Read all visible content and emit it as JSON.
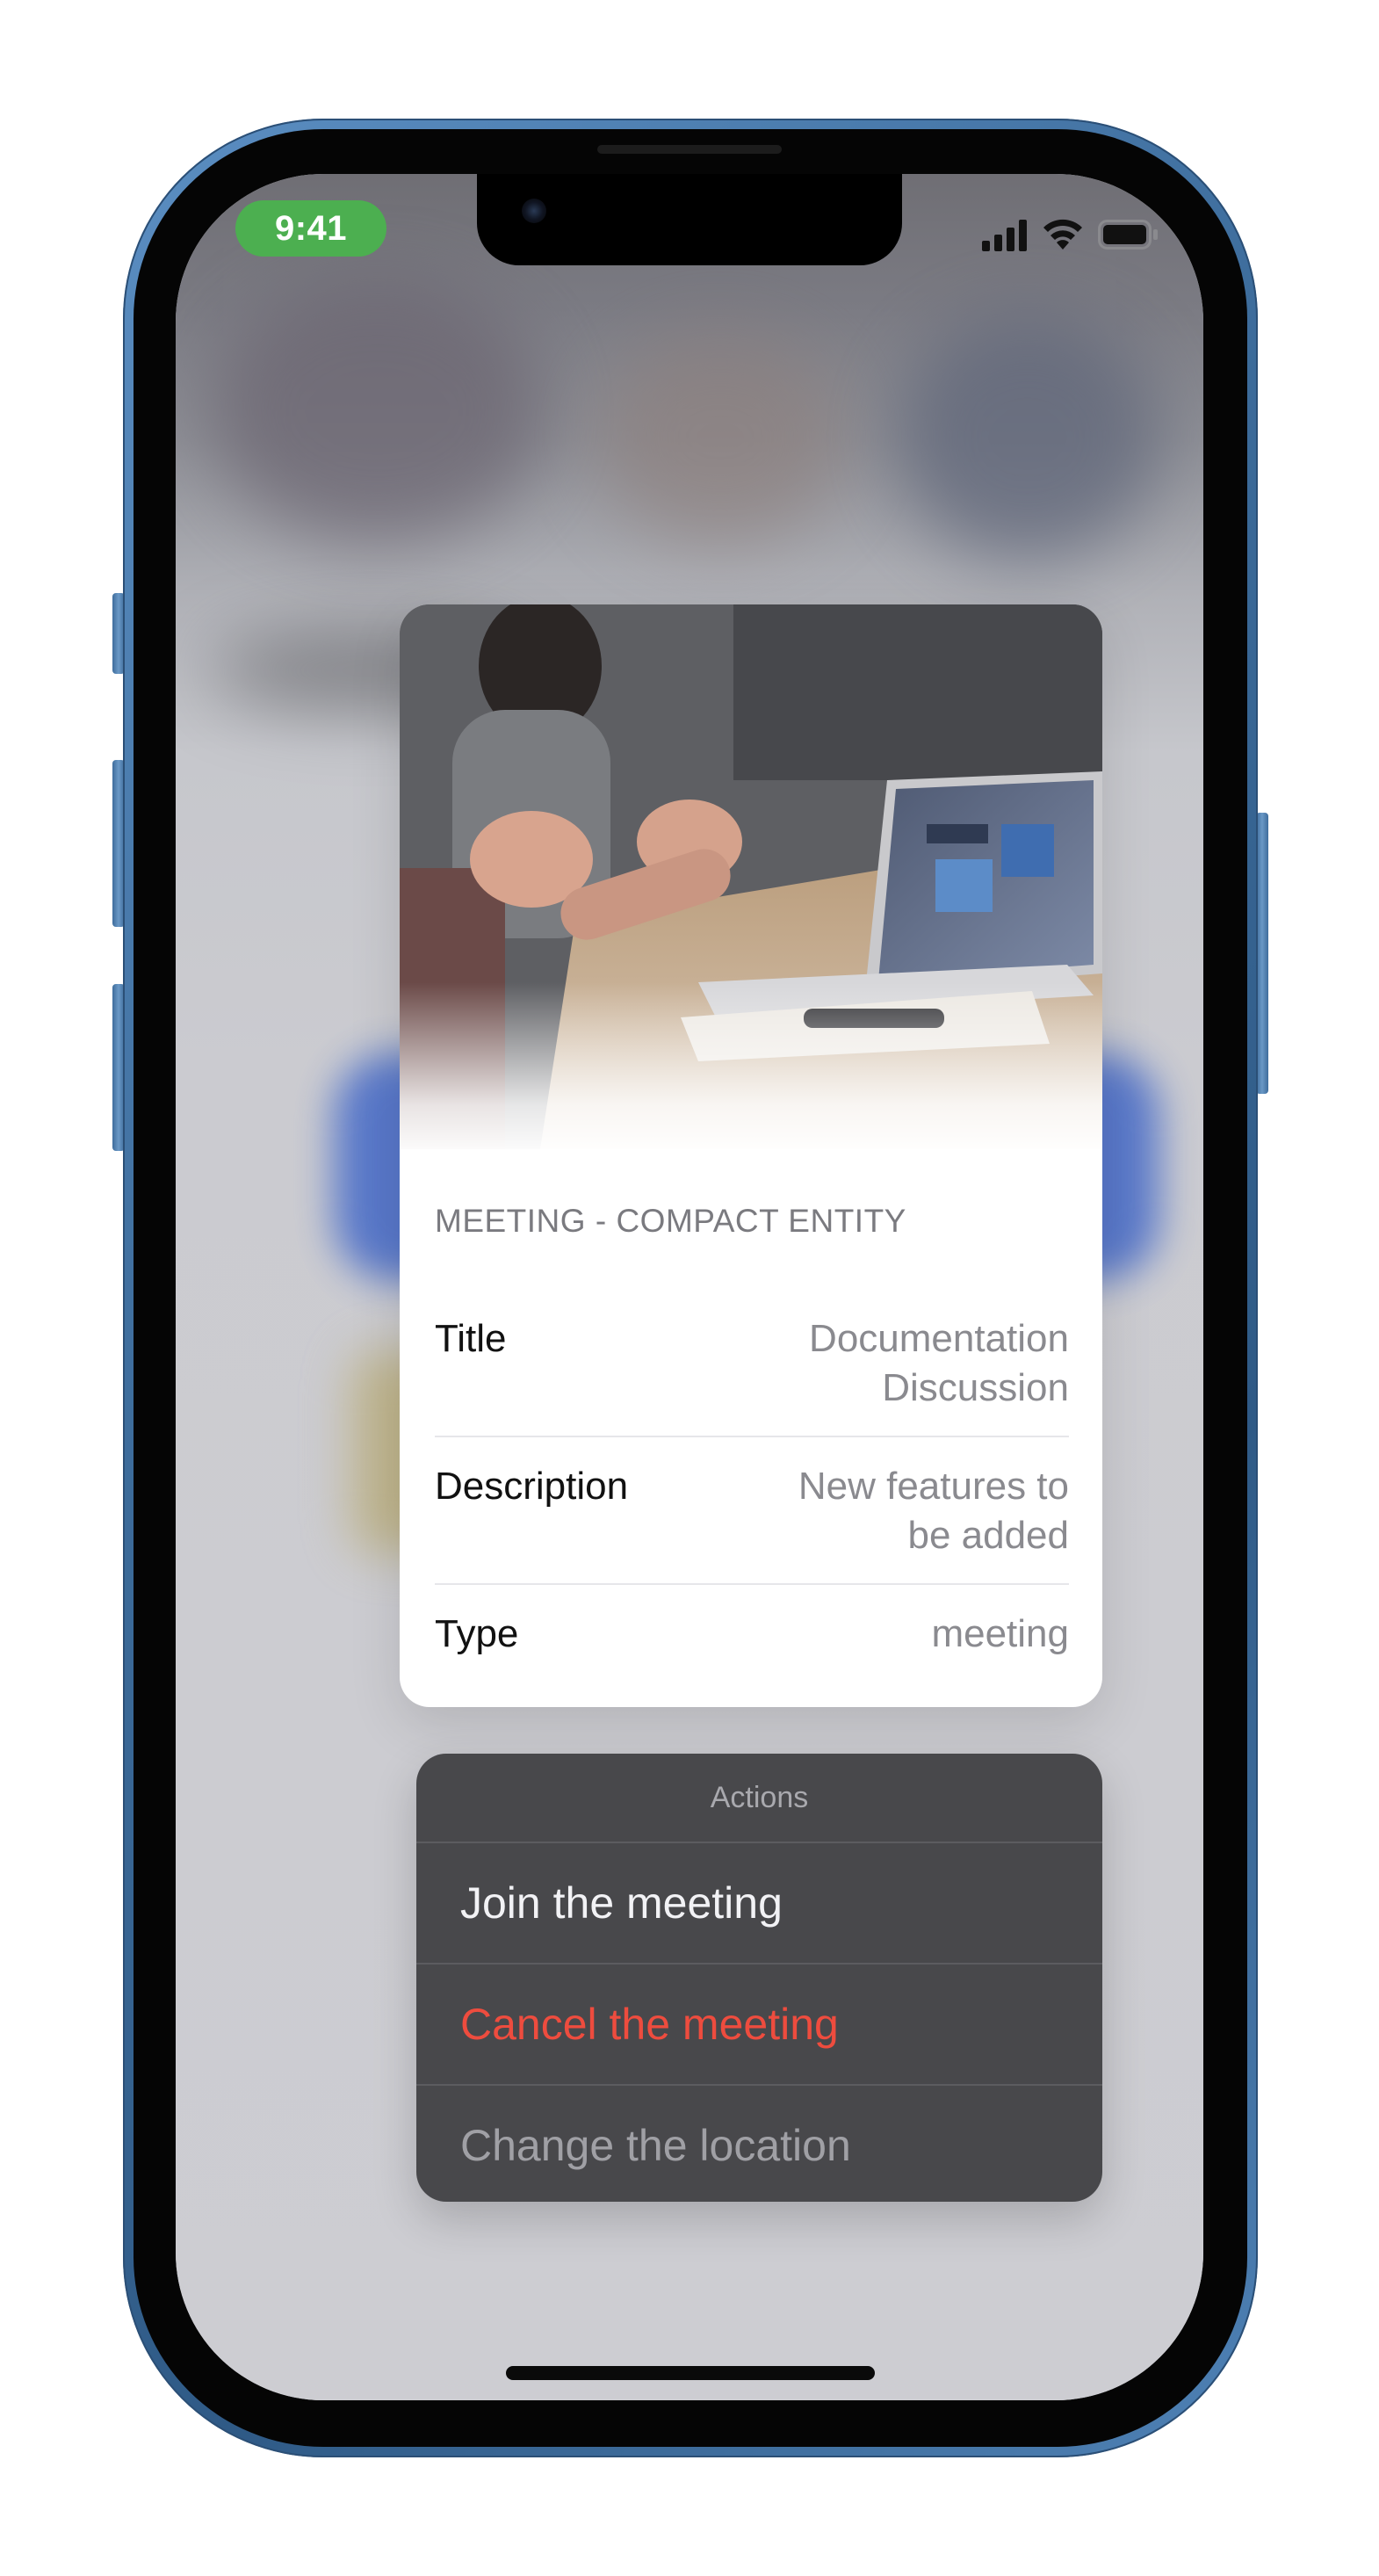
{
  "status_bar": {
    "time": "9:41",
    "signal_icon": "cellular-signal-icon",
    "wifi_icon": "wifi-icon",
    "battery_icon": "battery-icon",
    "time_pill_color": "#4caf50"
  },
  "preview_card": {
    "image_description_icon": "meeting-photo",
    "header": "MEETING - COMPACT ENTITY",
    "rows": [
      {
        "key": "Title",
        "value_line1": "Documentation",
        "value_line2": "Discussion"
      },
      {
        "key": "Description",
        "value_line1": "New features to",
        "value_line2": "be added"
      },
      {
        "key": "Type",
        "value_line1": "meeting",
        "value_line2": ""
      }
    ]
  },
  "actions_menu": {
    "title": "Actions",
    "items": [
      {
        "label": "Join the meeting",
        "color": "#f2f2f5"
      },
      {
        "label": "Cancel the meeting",
        "color": "#ee4c3e"
      },
      {
        "label": "Change the location",
        "color": "#a0a0a5"
      }
    ]
  }
}
